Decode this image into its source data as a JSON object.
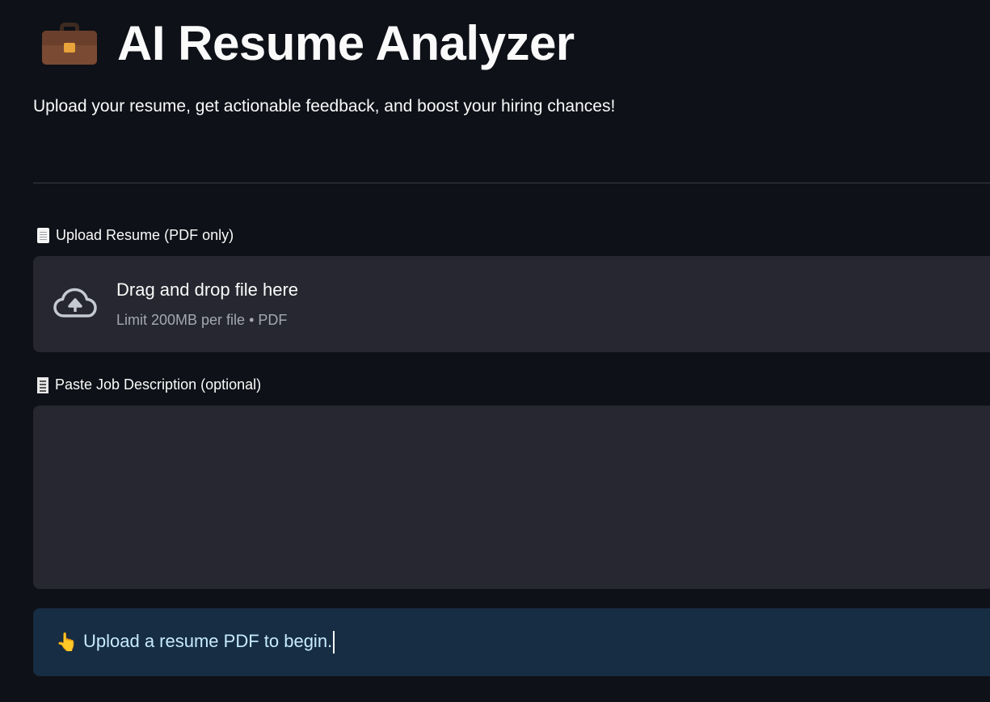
{
  "header": {
    "title": "AI Resume Analyzer",
    "title_icon": "briefcase-icon",
    "subtitle": "Upload your resume, get actionable feedback, and boost your hiring chances!"
  },
  "upload": {
    "label": "Upload Resume (PDF only)",
    "label_icon": "page-icon",
    "dropzone_title": "Drag and drop file here",
    "dropzone_hint": "Limit 200MB per file • PDF",
    "dropzone_icon": "cloud-upload-icon"
  },
  "job_description": {
    "label": "Paste Job Description (optional)",
    "label_icon": "receipt-icon",
    "value": "",
    "placeholder": ""
  },
  "info": {
    "icon": "pointing-hand-icon",
    "message": "Upload a resume PDF to begin."
  },
  "colors": {
    "background": "#0e1117",
    "surface": "#262730",
    "info_background": "#172d43",
    "info_text": "#c7ebff"
  }
}
